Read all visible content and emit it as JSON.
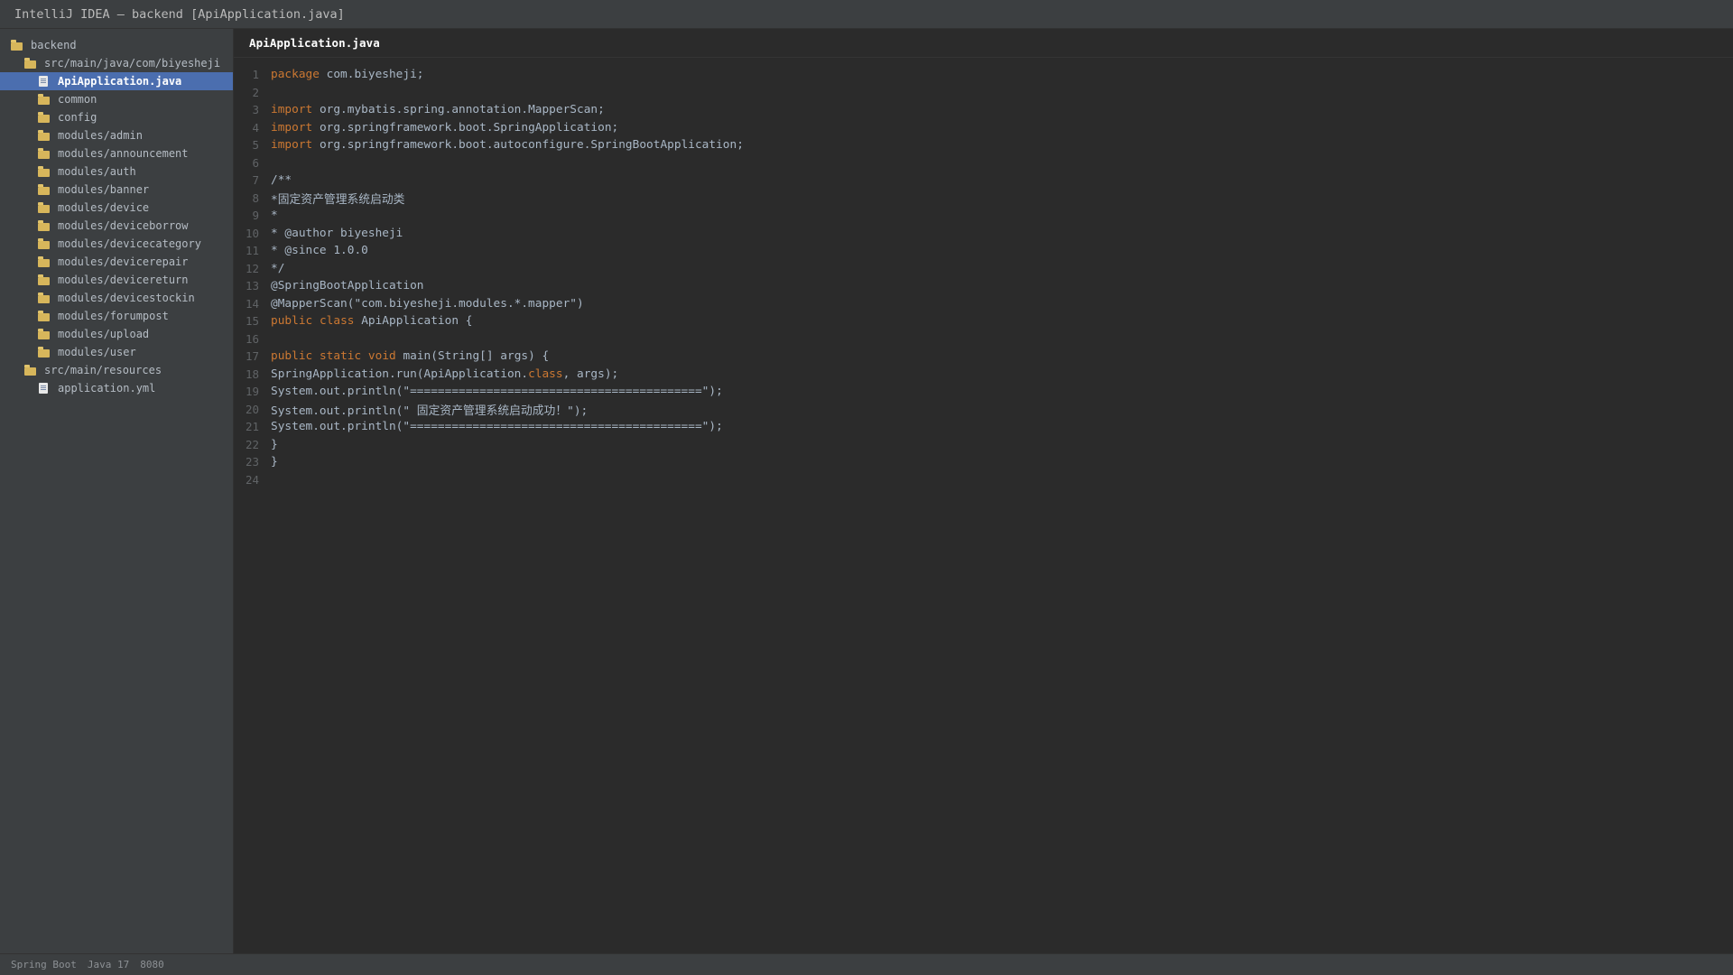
{
  "window": {
    "title": "IntelliJ IDEA — backend [ApiApplication.java]"
  },
  "sidebar": {
    "items": [
      {
        "label": "backend",
        "type": "folder",
        "depth": 0,
        "selected": false
      },
      {
        "label": "src/main/java/com/biyesheji",
        "type": "folder",
        "depth": 1,
        "selected": false
      },
      {
        "label": "ApiApplication.java",
        "type": "file",
        "depth": 2,
        "selected": true
      },
      {
        "label": "common",
        "type": "folder",
        "depth": 2,
        "selected": false
      },
      {
        "label": "config",
        "type": "folder",
        "depth": 2,
        "selected": false
      },
      {
        "label": "modules/admin",
        "type": "folder",
        "depth": 2,
        "selected": false
      },
      {
        "label": "modules/announcement",
        "type": "folder",
        "depth": 2,
        "selected": false
      },
      {
        "label": "modules/auth",
        "type": "folder",
        "depth": 2,
        "selected": false
      },
      {
        "label": "modules/banner",
        "type": "folder",
        "depth": 2,
        "selected": false
      },
      {
        "label": "modules/device",
        "type": "folder",
        "depth": 2,
        "selected": false
      },
      {
        "label": "modules/deviceborrow",
        "type": "folder",
        "depth": 2,
        "selected": false
      },
      {
        "label": "modules/devicecategory",
        "type": "folder",
        "depth": 2,
        "selected": false
      },
      {
        "label": "modules/devicerepair",
        "type": "folder",
        "depth": 2,
        "selected": false
      },
      {
        "label": "modules/devicereturn",
        "type": "folder",
        "depth": 2,
        "selected": false
      },
      {
        "label": "modules/devicestockin",
        "type": "folder",
        "depth": 2,
        "selected": false
      },
      {
        "label": "modules/forumpost",
        "type": "folder",
        "depth": 2,
        "selected": false
      },
      {
        "label": "modules/upload",
        "type": "folder",
        "depth": 2,
        "selected": false
      },
      {
        "label": "modules/user",
        "type": "folder",
        "depth": 2,
        "selected": false
      },
      {
        "label": "src/main/resources",
        "type": "folder",
        "depth": 1,
        "selected": false
      },
      {
        "label": "application.yml",
        "type": "file",
        "depth": 2,
        "selected": false
      }
    ]
  },
  "editor": {
    "active_tab": "ApiApplication.java",
    "lines": [
      [
        {
          "k": true,
          "t": "package"
        },
        {
          "t": " com.biyesheji;"
        }
      ],
      [],
      [
        {
          "k": true,
          "t": "import"
        },
        {
          "t": " org.mybatis.spring.annotation.MapperScan;"
        }
      ],
      [
        {
          "k": true,
          "t": "import"
        },
        {
          "t": " org.springframework.boot.SpringApplication;"
        }
      ],
      [
        {
          "k": true,
          "t": "import"
        },
        {
          "t": " org.springframework.boot.autoconfigure.SpringBootApplication;"
        }
      ],
      [],
      [
        {
          "t": "/**"
        }
      ],
      [
        {
          "t": "*固定资产管理系统启动类"
        }
      ],
      [
        {
          "t": "*"
        }
      ],
      [
        {
          "t": "* @author biyesheji"
        }
      ],
      [
        {
          "t": "* @since 1.0.0"
        }
      ],
      [
        {
          "t": "*/"
        }
      ],
      [
        {
          "t": "@SpringBootApplication"
        }
      ],
      [
        {
          "t": "@MapperScan(\"com.biyesheji.modules.*.mapper\")"
        }
      ],
      [
        {
          "k": true,
          "t": "public"
        },
        {
          "t": " "
        },
        {
          "k": true,
          "t": "class"
        },
        {
          "t": " ApiApplication {"
        }
      ],
      [],
      [
        {
          "k": true,
          "t": "public"
        },
        {
          "t": " "
        },
        {
          "k": true,
          "t": "static"
        },
        {
          "t": " "
        },
        {
          "k": true,
          "t": "void"
        },
        {
          "t": " main(String[] args) {"
        }
      ],
      [
        {
          "t": "SpringApplication.run(ApiApplication."
        },
        {
          "k": true,
          "t": "class"
        },
        {
          "t": ", args);"
        }
      ],
      [
        {
          "t": "System.out.println(\"==========================================\");"
        }
      ],
      [
        {
          "t": "System.out.println(\" 固定资产管理系统启动成功！\");"
        }
      ],
      [
        {
          "t": "System.out.println(\"==========================================\");"
        }
      ],
      [
        {
          "t": "}"
        }
      ],
      [
        {
          "t": "}"
        }
      ],
      []
    ]
  },
  "statusbar": {
    "items": [
      "Spring Boot",
      "Java 17",
      "8080"
    ]
  },
  "colors": {
    "background": "#2b2b2b",
    "panel": "#3c3f41",
    "selection": "#4b6eaf",
    "keyword": "#cc7832",
    "text": "#a9b7c6",
    "line_number": "#606366",
    "folder_icon": "#d7b65b"
  }
}
